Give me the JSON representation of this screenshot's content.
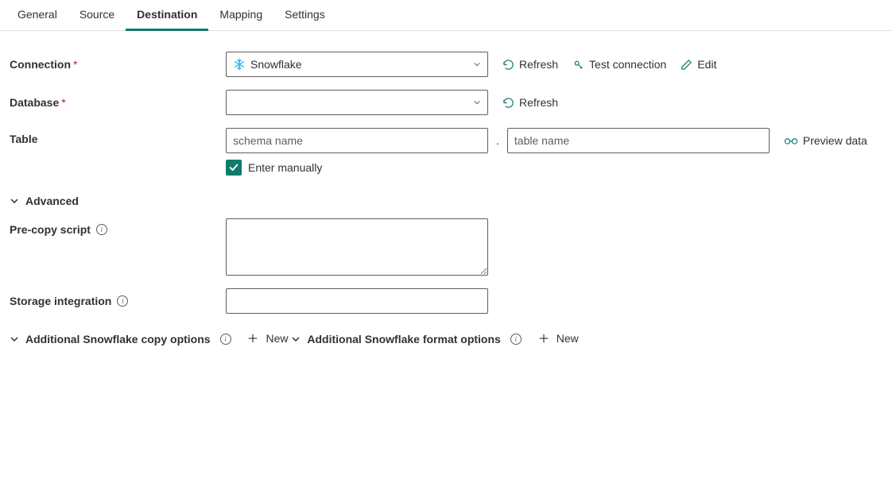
{
  "tabs": {
    "general": "General",
    "source": "Source",
    "destination": "Destination",
    "mapping": "Mapping",
    "settings": "Settings",
    "active": "destination"
  },
  "labels": {
    "connection": "Connection",
    "database": "Database",
    "table": "Table",
    "precopy": "Pre-copy script",
    "storage_integration": "Storage integration"
  },
  "connection": {
    "value": "Snowflake",
    "icon": "snowflake"
  },
  "database": {
    "value": ""
  },
  "table": {
    "schema_placeholder": "schema name",
    "table_placeholder": "table name",
    "enter_manually_label": "Enter manually",
    "enter_manually_checked": true
  },
  "actions": {
    "refresh": "Refresh",
    "test_connection": "Test connection",
    "edit": "Edit",
    "preview_data": "Preview data",
    "new": "New"
  },
  "sections": {
    "advanced": "Advanced",
    "addl_copy": "Additional Snowflake copy options",
    "addl_format": "Additional Snowflake format options"
  },
  "precopy_script": {
    "value": ""
  },
  "storage_integration": {
    "value": ""
  }
}
